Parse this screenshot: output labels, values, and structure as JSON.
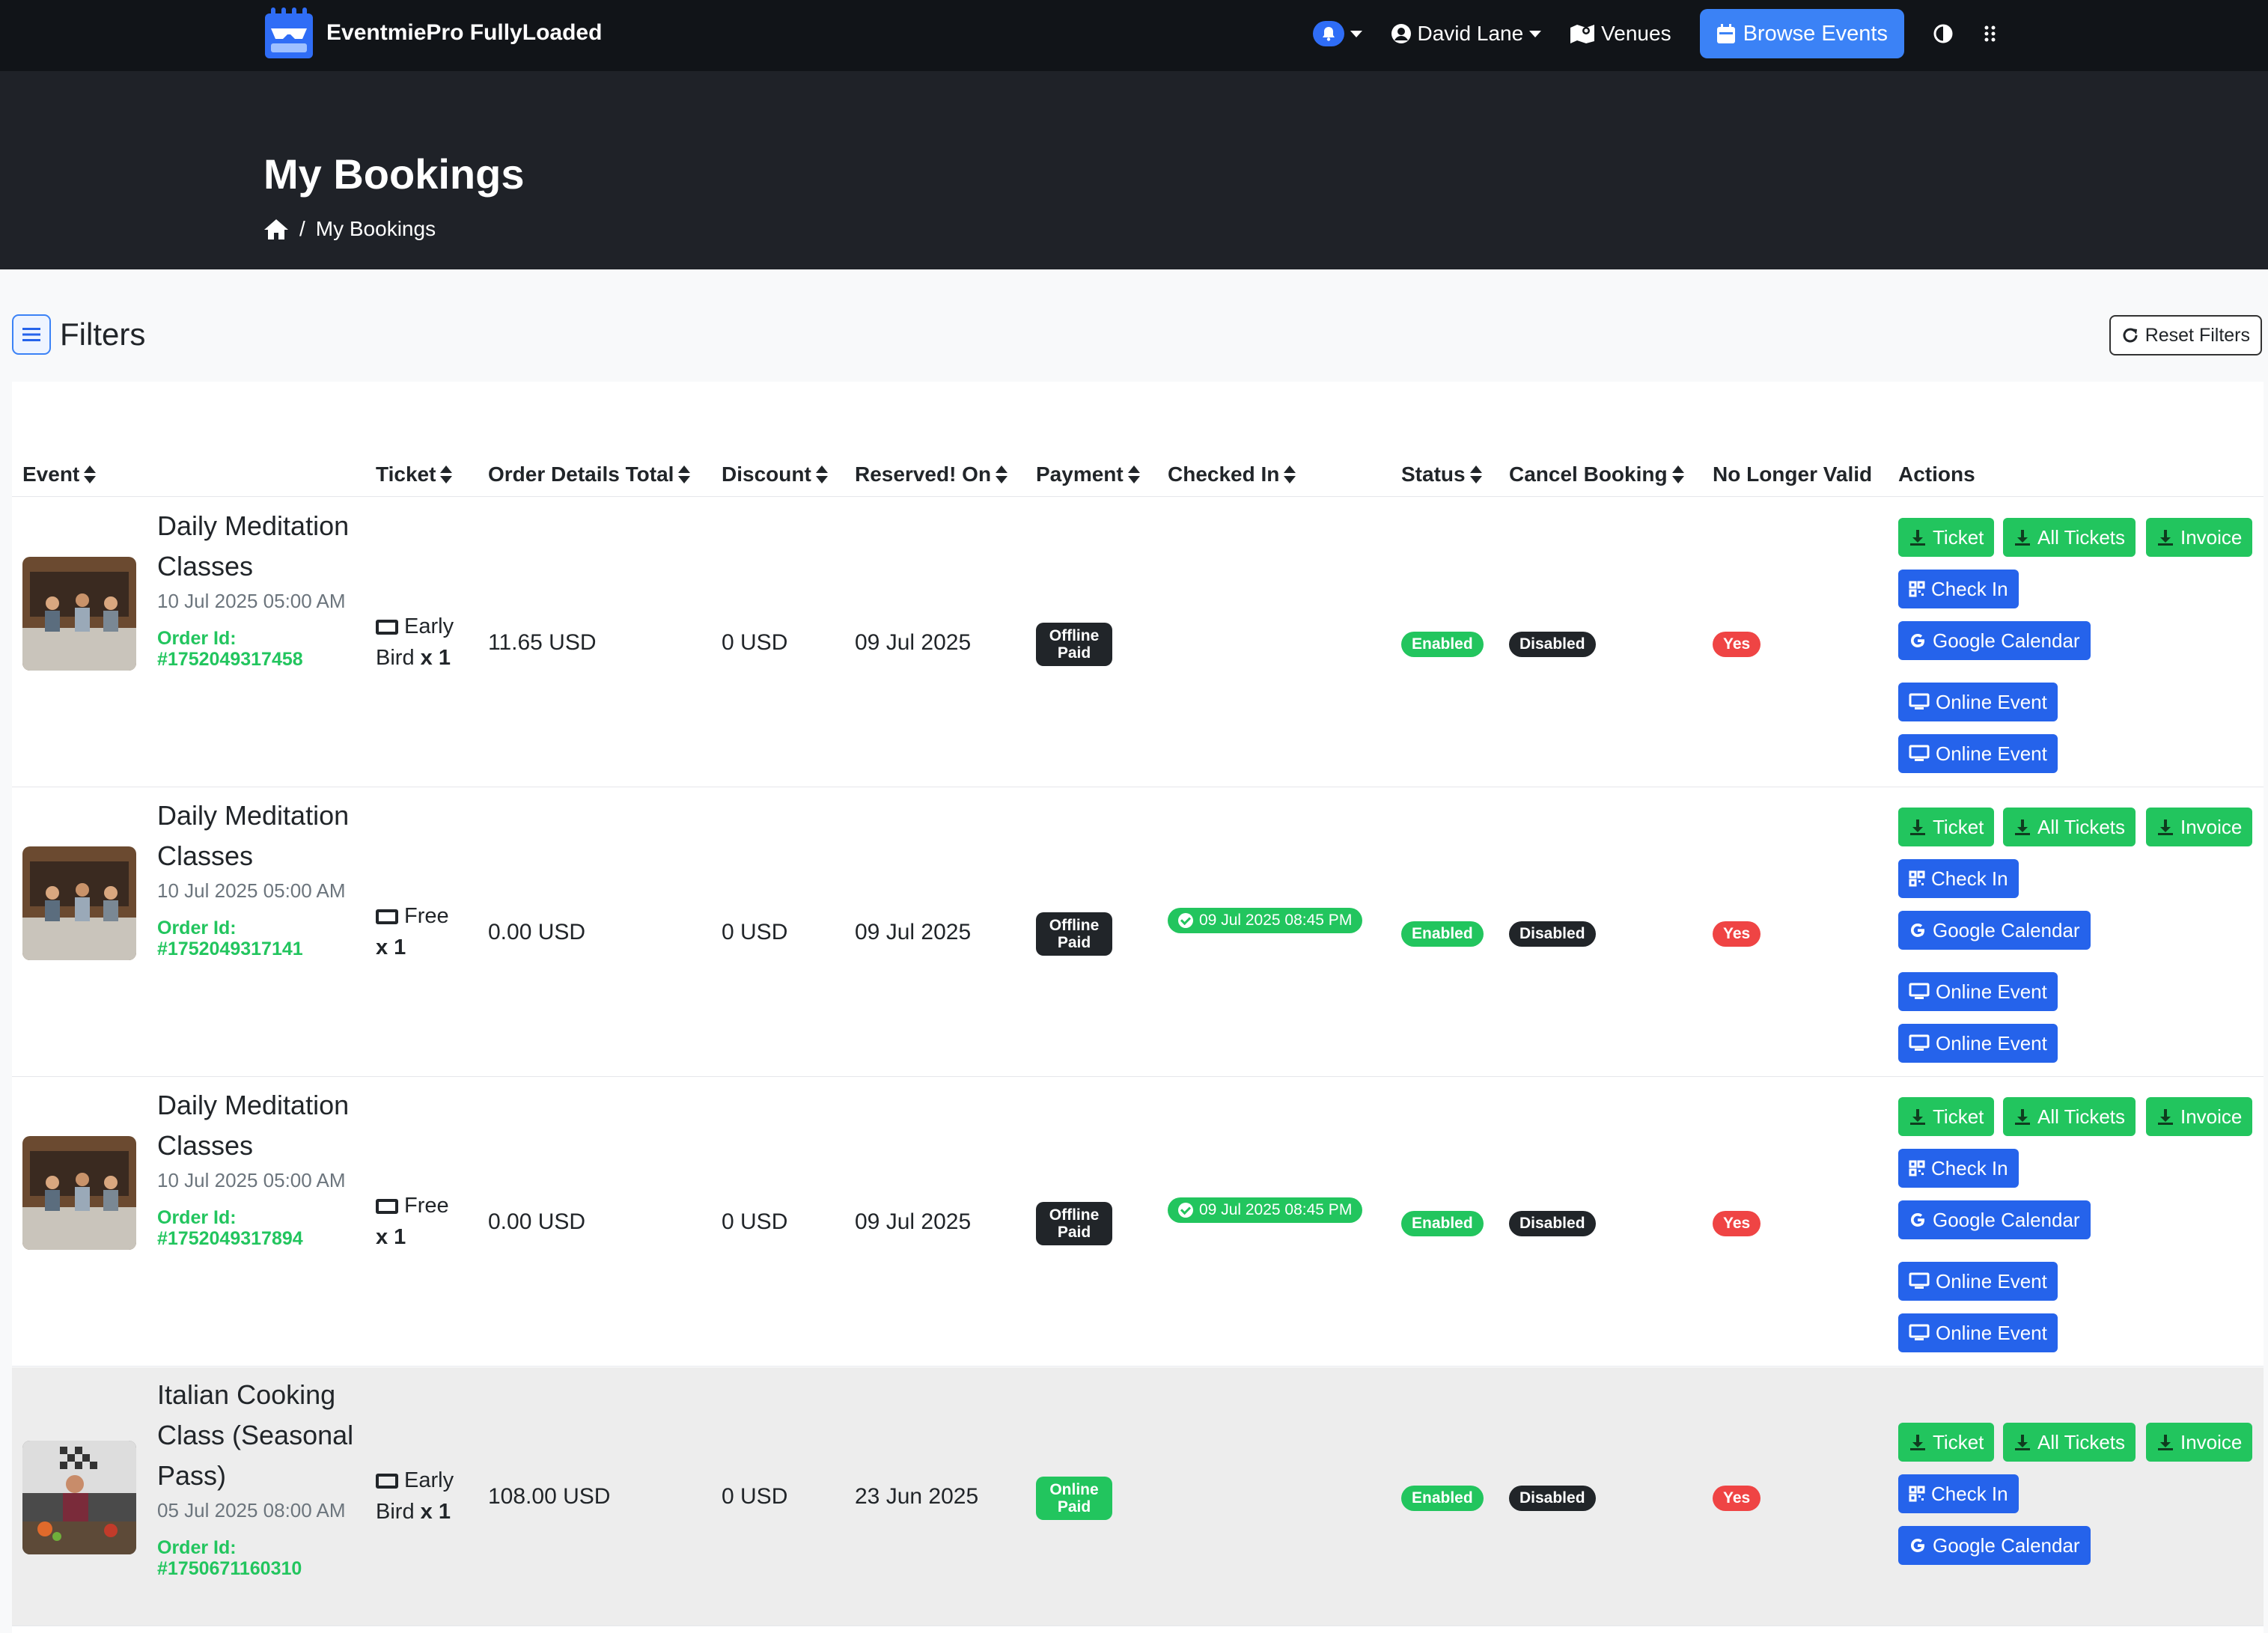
{
  "header": {
    "brand": "EventmiePro FullyLoaded",
    "user": "David Lane",
    "venues": "Venues",
    "browse": "Browse Events"
  },
  "hero": {
    "title": "My Bookings",
    "breadcrumb": "My Bookings"
  },
  "filters": {
    "title": "Filters",
    "reset": "Reset Filters"
  },
  "columns": {
    "event": "Event",
    "ticket": "Ticket",
    "total": "Order Details Total",
    "discount": "Discount",
    "reserved": "Reserved! On",
    "payment": "Payment",
    "checked": "Checked In",
    "status": "Status",
    "cancel": "Cancel Booking",
    "valid": "No Longer Valid",
    "actions": "Actions"
  },
  "actions": {
    "ticket": "Ticket",
    "all": "All Tickets",
    "invoice": "Invoice",
    "checkin": "Check In",
    "gcal": "Google Calendar",
    "online": "Online Event"
  },
  "rows": [
    {
      "name1": "Daily Meditation",
      "name2": "Classes",
      "name3": "",
      "date": "10 Jul 2025 05:00 AM",
      "order_label": "Order Id:",
      "order_id": "#1752049317458",
      "ticket1": "Early",
      "ticket2": "Bird",
      "qty": "x 1",
      "total": "11.65 USD",
      "discount": "0 USD",
      "reserved": "09 Jul 2025",
      "pay1": "Offline",
      "pay2": "Paid",
      "checked": "",
      "status": "Enabled",
      "cancel": "Disabled",
      "valid": "Yes"
    },
    {
      "name1": "Daily Meditation",
      "name2": "Classes",
      "name3": "",
      "date": "10 Jul 2025 05:00 AM",
      "order_label": "Order Id:",
      "order_id": "#1752049317141",
      "ticket1": "Free",
      "ticket2": "",
      "qty": "x 1",
      "total": "0.00 USD",
      "discount": "0 USD",
      "reserved": "09 Jul 2025",
      "pay1": "Offline",
      "pay2": "Paid",
      "checked": "09 Jul 2025 08:45 PM",
      "status": "Enabled",
      "cancel": "Disabled",
      "valid": "Yes"
    },
    {
      "name1": "Daily Meditation",
      "name2": "Classes",
      "name3": "",
      "date": "10 Jul 2025 05:00 AM",
      "order_label": "Order Id:",
      "order_id": "#1752049317894",
      "ticket1": "Free",
      "ticket2": "",
      "qty": "x 1",
      "total": "0.00 USD",
      "discount": "0 USD",
      "reserved": "09 Jul 2025",
      "pay1": "Offline",
      "pay2": "Paid",
      "checked": "09 Jul 2025 08:45 PM",
      "status": "Enabled",
      "cancel": "Disabled",
      "valid": "Yes"
    },
    {
      "name1": "Italian Cooking",
      "name2": "Class (Seasonal",
      "name3": "Pass)",
      "date": "05 Jul 2025 08:00 AM",
      "order_label": "Order Id:",
      "order_id": "#1750671160310",
      "ticket1": "Early",
      "ticket2": "Bird",
      "qty": "x 1",
      "total": "108.00 USD",
      "discount": "0 USD",
      "reserved": "23 Jun 2025",
      "pay1": "Online",
      "pay2": "Paid",
      "checked": "",
      "status": "Enabled",
      "cancel": "Disabled",
      "valid": "Yes"
    }
  ]
}
